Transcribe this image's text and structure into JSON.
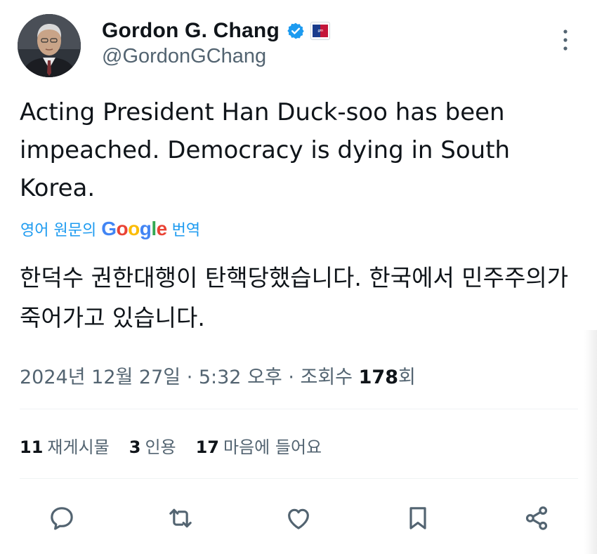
{
  "author": {
    "name": "Gordon G. Chang",
    "handle": "@GordonGChang",
    "avatar_icon": "user-avatar",
    "verified_icon": "verified-badge-icon",
    "affiliate_icon": "affiliate-badge-icon"
  },
  "tweet": {
    "text": "Acting President Han Duck-soo has been impeached. Democracy is dying in South Korea.",
    "translate_prefix": "영어 원문의",
    "translate_brand": "Google",
    "translate_suffix": "번역",
    "translated_text": "한덕수 권한대행이 탄핵당했습니다. 한국에서 민주주의가 죽어가고 있습니다."
  },
  "meta": {
    "timestamp": "2024년 12월 27일 · 5:32 오후 · 조회수",
    "views": "178",
    "views_suffix": "회"
  },
  "stats": {
    "reposts_count": "11",
    "reposts_label": "재게시물",
    "quotes_count": "3",
    "quotes_label": "인용",
    "likes_count": "17",
    "likes_label": "마음에 들어요"
  },
  "actions": [
    "reply-icon",
    "repost-icon",
    "like-icon",
    "bookmark-icon",
    "share-icon"
  ],
  "colors": {
    "accent": "#1d9bf0",
    "secondary_text": "#536471",
    "primary_text": "#0f1419",
    "google_blue": "#4285f4",
    "google_red": "#ea4335",
    "google_yellow": "#fbbc05",
    "google_green": "#34a853"
  }
}
